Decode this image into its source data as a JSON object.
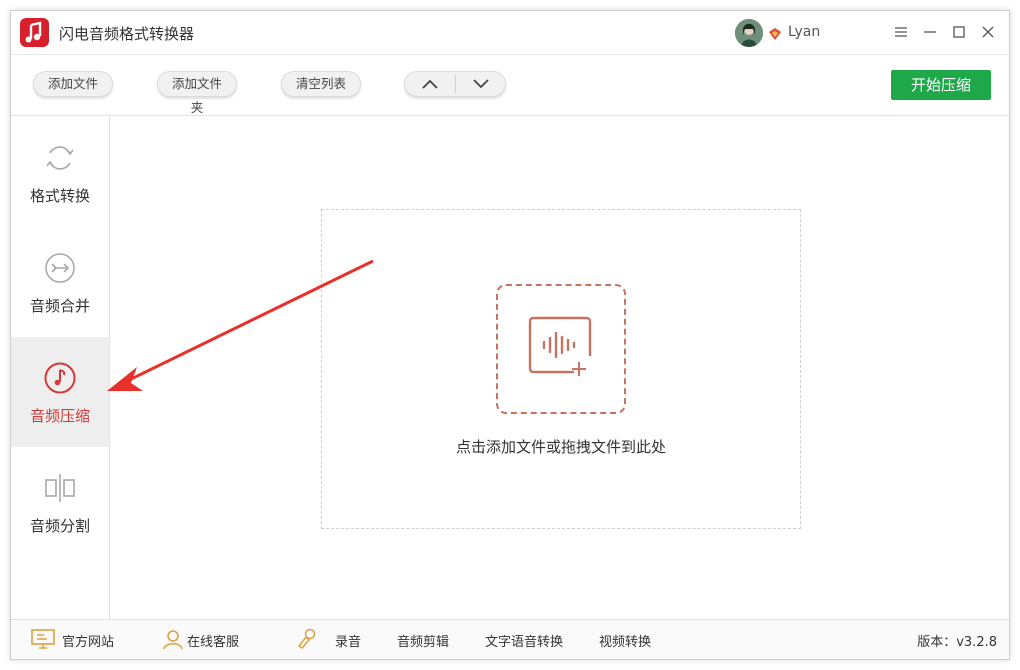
{
  "app": {
    "title": "闪电音频格式转换器",
    "username": "Lyan",
    "brand_color": "#d8202c",
    "accent_color": "#1ea84a",
    "active_color": "#d23a3a"
  },
  "window_controls": {
    "menu": "menu-icon",
    "minimize": "minimize-icon",
    "maximize": "maximize-icon",
    "close": "close-icon"
  },
  "toolbar": {
    "add_file": "添加文件",
    "add_folder": "添加文件夹",
    "clear_list": "清空列表",
    "move_up": "move-up-icon",
    "move_down": "move-down-icon",
    "start_compress": "开始压缩"
  },
  "sidebar": {
    "items": [
      {
        "label": "格式转换",
        "icon": "refresh-icon",
        "active": false
      },
      {
        "label": "音频合并",
        "icon": "merge-icon",
        "active": false
      },
      {
        "label": "音频压缩",
        "icon": "music-note-icon",
        "active": true
      },
      {
        "label": "音频分割",
        "icon": "split-icon",
        "active": false
      }
    ]
  },
  "main": {
    "drop_hint": "点击添加文件或拖拽文件到此处",
    "drop_icon": "add-audio-icon"
  },
  "footer": {
    "official_site": "官方网站",
    "online_service": "在线客服",
    "record": "录音",
    "audio_edit": "音频剪辑",
    "tts": "文字语音转换",
    "video_convert": "视频转换",
    "version": "版本：v3.2.8"
  }
}
